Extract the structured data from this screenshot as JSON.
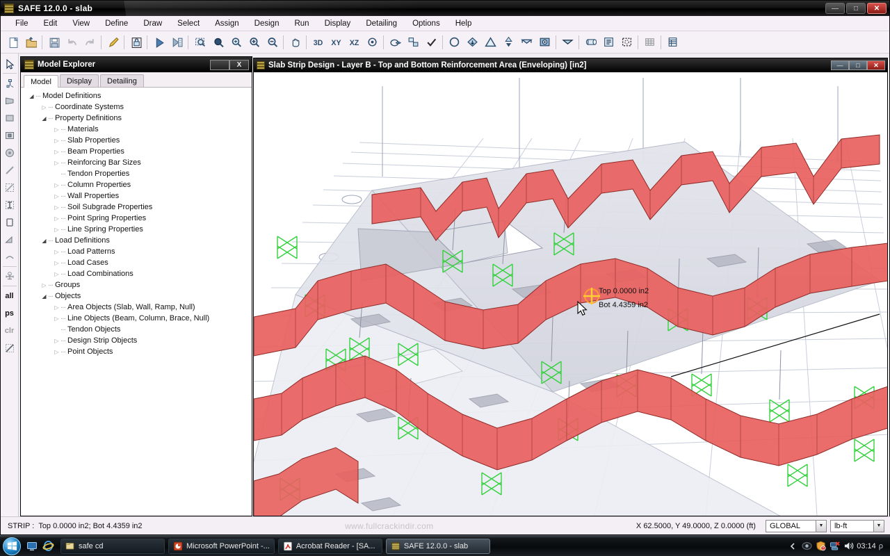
{
  "window": {
    "title": "SAFE 12.0.0 - slab",
    "app_icon": "safe-app-icon",
    "minimize": "—",
    "maximize": "□",
    "close": "✕"
  },
  "menubar": {
    "items": [
      "File",
      "Edit",
      "View",
      "Define",
      "Draw",
      "Select",
      "Assign",
      "Design",
      "Run",
      "Display",
      "Detailing",
      "Options",
      "Help"
    ]
  },
  "toolbar": {
    "items": [
      {
        "name": "new-file-icon",
        "glyph": "doc"
      },
      {
        "name": "open-file-icon",
        "glyph": "folder"
      },
      {
        "sep": true
      },
      {
        "name": "save-icon",
        "glyph": "save"
      },
      {
        "name": "undo-icon",
        "glyph": "undo"
      },
      {
        "name": "redo-icon",
        "glyph": "redo"
      },
      {
        "sep": true
      },
      {
        "name": "edit-pencil-icon",
        "glyph": "pencil"
      },
      {
        "sep": true
      },
      {
        "name": "lock-model-icon",
        "glyph": "lock"
      },
      {
        "sep": true
      },
      {
        "name": "run-analysis-icon",
        "glyph": "play"
      },
      {
        "name": "run-design-icon",
        "glyph": "rundesign"
      },
      {
        "sep": true
      },
      {
        "name": "rubber-band-zoom-icon",
        "glyph": "zoomrect"
      },
      {
        "name": "restore-full-view-icon",
        "glyph": "zoomfull"
      },
      {
        "name": "previous-zoom-icon",
        "glyph": "zoomprev"
      },
      {
        "name": "zoom-in-icon",
        "glyph": "zoomin"
      },
      {
        "name": "zoom-out-icon",
        "glyph": "zoomout"
      },
      {
        "sep": true
      },
      {
        "name": "pan-hand-icon",
        "glyph": "pan"
      },
      {
        "sep": true
      },
      {
        "name": "set-3d-view-icon",
        "glyph": "3d"
      },
      {
        "name": "set-plan-view-icon",
        "glyph": "xy"
      },
      {
        "name": "set-elevation-view-icon",
        "glyph": "xz"
      },
      {
        "name": "perspective-toggle-icon",
        "glyph": "persp"
      },
      {
        "sep": true
      },
      {
        "name": "object-shrink-icon",
        "glyph": "shrink"
      },
      {
        "name": "assign-to-group-icon",
        "glyph": "group"
      },
      {
        "name": "check-model-icon",
        "glyph": "check"
      },
      {
        "sep": true
      },
      {
        "name": "draw-slab-icon",
        "glyph": "circle"
      },
      {
        "name": "draw-beam-icon",
        "glyph": "diamond"
      },
      {
        "name": "draw-load-icon",
        "glyph": "triangle"
      },
      {
        "name": "show-deformed-shape-icon",
        "glyph": "updown"
      },
      {
        "name": "show-reactions-icon",
        "glyph": "bowtie"
      },
      {
        "name": "show-contours-icon",
        "glyph": "contour"
      },
      {
        "sep": true
      },
      {
        "name": "display-strip-forces-icon",
        "glyph": "bowtie2"
      },
      {
        "sep": true
      },
      {
        "name": "show-tables-icon",
        "glyph": "rolled"
      },
      {
        "name": "show-report-icon",
        "glyph": "report"
      },
      {
        "name": "select-window-icon",
        "glyph": "selwin"
      },
      {
        "sep": true
      },
      {
        "name": "grid-toggle-icon",
        "glyph": "grid"
      },
      {
        "sep": true
      },
      {
        "name": "database-tables-icon",
        "glyph": "table"
      }
    ]
  },
  "left_toolbar": {
    "items": [
      {
        "name": "select-pointer-tool",
        "glyph": "arrow"
      },
      {
        "name": "reshape-object-tool",
        "glyph": "reshape"
      },
      {
        "name": "draw-quad-area-tool",
        "glyph": "quad"
      },
      {
        "name": "draw-rect-area-tool",
        "glyph": "rect"
      },
      {
        "name": "draw-slab-in-region-tool",
        "glyph": "rectin"
      },
      {
        "name": "draw-circular-area-tool",
        "glyph": "circ"
      },
      {
        "name": "draw-line-object-tool",
        "glyph": "line"
      },
      {
        "name": "draw-line-in-region-tool",
        "glyph": "linerect"
      },
      {
        "name": "draw-design-strip-tool",
        "glyph": "strip"
      },
      {
        "name": "draw-tendon-tool",
        "glyph": "tendon"
      },
      {
        "name": "quick-draw-area-tool",
        "glyph": "quickarea"
      },
      {
        "name": "draw-point-objects-tool",
        "glyph": "points"
      },
      {
        "name": "draw-dimension-line-tool",
        "glyph": "dimline"
      },
      {
        "name": "select-all-button",
        "text": "all"
      },
      {
        "name": "get-previous-selection-button",
        "text": "ps"
      },
      {
        "name": "clear-selection-button",
        "text": "clr",
        "dim": true
      },
      {
        "name": "deselect-tool",
        "glyph": "deselect"
      }
    ]
  },
  "explorer": {
    "title": "Model Explorer",
    "icon": "model-explorer-icon",
    "restore_label": "",
    "close_label": "X",
    "tabs": [
      {
        "label": "Model",
        "active": true
      },
      {
        "label": "Display",
        "active": false
      },
      {
        "label": "Detailing",
        "active": false
      }
    ],
    "tree": [
      {
        "label": "Model Definitions",
        "depth": 0,
        "state": "expanded"
      },
      {
        "label": "Coordinate Systems",
        "depth": 1,
        "state": "collapsed"
      },
      {
        "label": "Property Definitions",
        "depth": 1,
        "state": "expanded"
      },
      {
        "label": "Materials",
        "depth": 2,
        "state": "collapsed"
      },
      {
        "label": "Slab Properties",
        "depth": 2,
        "state": "collapsed"
      },
      {
        "label": "Beam Properties",
        "depth": 2,
        "state": "collapsed"
      },
      {
        "label": "Reinforcing Bar Sizes",
        "depth": 2,
        "state": "collapsed"
      },
      {
        "label": "Tendon Properties",
        "depth": 2,
        "state": "leaf"
      },
      {
        "label": "Column Properties",
        "depth": 2,
        "state": "collapsed"
      },
      {
        "label": "Wall Properties",
        "depth": 2,
        "state": "collapsed"
      },
      {
        "label": "Soil Subgrade Properties",
        "depth": 2,
        "state": "collapsed"
      },
      {
        "label": "Point Spring Properties",
        "depth": 2,
        "state": "collapsed"
      },
      {
        "label": "Line Spring Properties",
        "depth": 2,
        "state": "collapsed"
      },
      {
        "label": "Load Definitions",
        "depth": 1,
        "state": "expanded"
      },
      {
        "label": "Load Patterns",
        "depth": 2,
        "state": "collapsed"
      },
      {
        "label": "Load Cases",
        "depth": 2,
        "state": "collapsed"
      },
      {
        "label": "Load Combinations",
        "depth": 2,
        "state": "collapsed"
      },
      {
        "label": "Groups",
        "depth": 1,
        "state": "collapsed"
      },
      {
        "label": "Objects",
        "depth": 1,
        "state": "expanded"
      },
      {
        "label": "Area Objects (Slab, Wall, Ramp, Null)",
        "depth": 2,
        "state": "collapsed"
      },
      {
        "label": "Line Objects (Beam, Column, Brace, Null)",
        "depth": 2,
        "state": "collapsed"
      },
      {
        "label": "Tendon Objects",
        "depth": 2,
        "state": "leaf"
      },
      {
        "label": "Design Strip Objects",
        "depth": 2,
        "state": "collapsed"
      },
      {
        "label": "Point Objects",
        "depth": 2,
        "state": "collapsed"
      }
    ]
  },
  "view_window": {
    "title": "Slab Strip Design - Layer B - Top and Bottom Reinforcement Area (Enveloping) [in2]",
    "icon": "view-window-icon",
    "minimize": "—",
    "maximize": "□",
    "close": "✕",
    "tooltip": {
      "top": "Top 0.0000 in2",
      "bot": "Bot 4.4359 in2"
    },
    "colors": {
      "diagram_fill": "#e8605e",
      "diagram_edge": "#8c2320",
      "slab_fill": "#dcdde6",
      "support_green": "#3fd54a",
      "highlight_orange": "#ff9a2e",
      "background": "#ffffff",
      "grid": "#c8ccd8"
    }
  },
  "status_bar": {
    "strip_label": "STRIP :",
    "strip_value": "Top 0.0000 in2; Bot 4.4359 in2",
    "watermark": "www.fullcrackindir.com",
    "coordinates": "X 62.5000, Y 49.0000, Z 0.0000  (ft)",
    "coord_system": "GLOBAL",
    "units": "lb-ft",
    "dropdown_arrow": "▼"
  },
  "taskbar": {
    "start_label": "start-orb",
    "quicklaunch": [
      {
        "name": "show-desktop-icon"
      },
      {
        "name": "internet-explorer-icon"
      }
    ],
    "buttons": [
      {
        "label": "safe cd",
        "icon": "folder-icon",
        "active": false
      },
      {
        "label": "Microsoft PowerPoint -...",
        "icon": "powerpoint-icon",
        "active": false
      },
      {
        "label": "Acrobat Reader - [SA...",
        "icon": "acrobat-icon",
        "active": false
      },
      {
        "label": "SAFE 12.0.0 - slab",
        "icon": "safe-app-icon",
        "active": true
      }
    ],
    "tray": [
      {
        "name": "hidden-icons-arrow"
      },
      {
        "name": "display-adapter-icon"
      },
      {
        "name": "security-alert-icon"
      },
      {
        "name": "network-disconnected-icon"
      },
      {
        "name": "volume-icon"
      }
    ],
    "clock": "03:14",
    "lang": "ρ"
  }
}
